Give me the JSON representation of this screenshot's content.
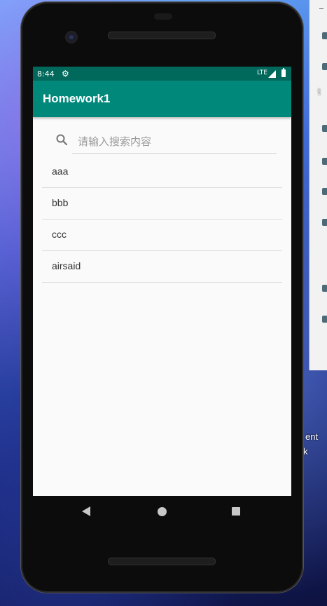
{
  "desktop": {
    "side_text_1": "t",
    "side_text_2": "ent",
    "side_text_3": "k"
  },
  "status_bar": {
    "time": "8:44",
    "network": "LTE",
    "icons": [
      "gear-icon",
      "signal-icon",
      "battery-icon"
    ]
  },
  "app_bar": {
    "title": "Homework1"
  },
  "search": {
    "placeholder": "请输入搜索内容",
    "value": "",
    "icon": "search-icon"
  },
  "list": {
    "items": [
      {
        "label": "aaa"
      },
      {
        "label": "bbb"
      },
      {
        "label": "ccc"
      },
      {
        "label": "airsaid"
      }
    ]
  },
  "nav_bar": {
    "icons": [
      "back-icon",
      "home-icon",
      "recents-icon"
    ]
  },
  "colors": {
    "status_bar": "#00695c",
    "app_bar": "#00897b",
    "screen_bg": "#fafafa"
  }
}
